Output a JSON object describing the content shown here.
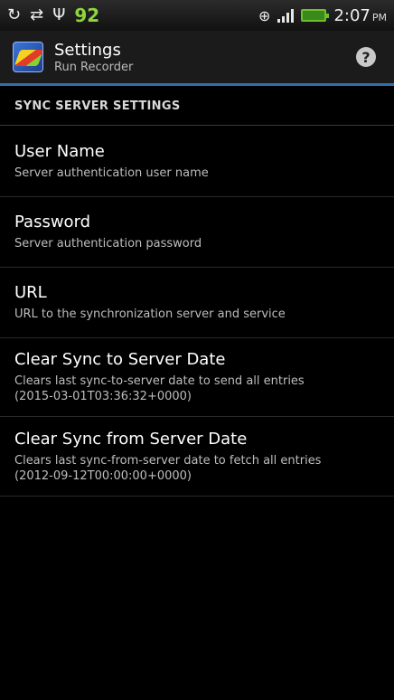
{
  "status_bar": {
    "left_icons": [
      "sync-icon",
      "data-transfer-icon",
      "usb-icon"
    ],
    "battery_percent": "92",
    "time": "2:07",
    "ampm": "PM"
  },
  "action_bar": {
    "title": "Settings",
    "subtitle": "Run Recorder",
    "help_label": "?"
  },
  "section": {
    "header": "SYNC SERVER SETTINGS"
  },
  "preferences": [
    {
      "title": "User Name",
      "summary": "Server authentication user name"
    },
    {
      "title": "Password",
      "summary": "Server authentication password"
    },
    {
      "title": "URL",
      "summary": "URL to the synchronization server and service"
    },
    {
      "title": "Clear Sync to Server Date",
      "summary": "Clears last sync-to-server date to send all entries",
      "summary2": "(2015-03-01T03:36:32+0000)"
    },
    {
      "title": "Clear Sync from Server Date",
      "summary": "Clears last sync-from-server date to fetch all entries",
      "summary2": "(2012-09-12T00:00:00+0000)"
    }
  ],
  "colors": {
    "accent": "#2f6fb0",
    "battery": "#8fd63a"
  }
}
